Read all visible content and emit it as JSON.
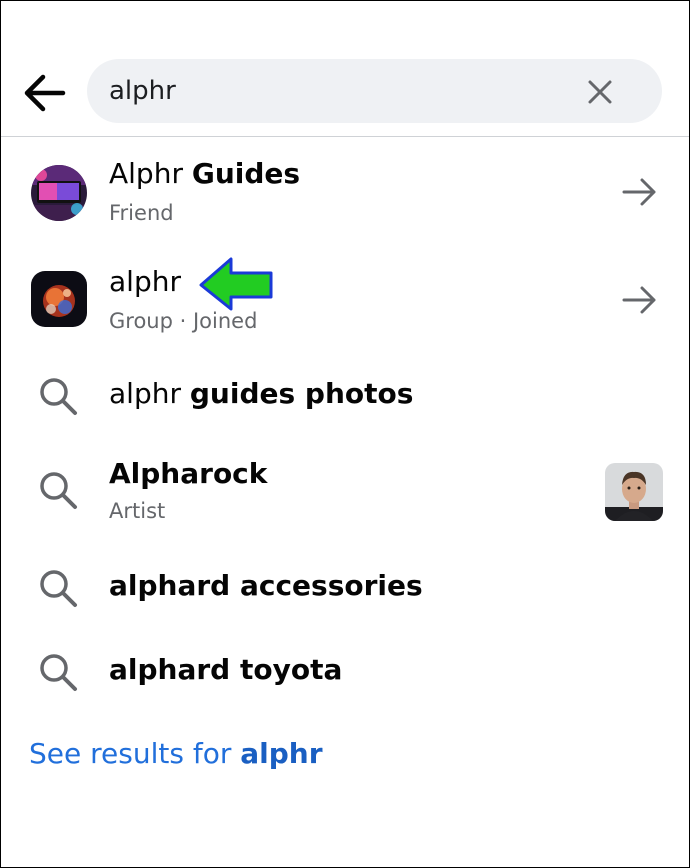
{
  "search": {
    "query": "alphr",
    "placeholder": ""
  },
  "results": {
    "alphr_guides": {
      "title_plain": "Alphr ",
      "title_bold": "Guides",
      "subtitle": "Friend"
    },
    "alphr_group": {
      "title": "alphr",
      "subtitle": "Group · Joined"
    },
    "alphr_guides_photos": {
      "plain": "alphr ",
      "bold": "guides photos"
    },
    "alpharock": {
      "title": "Alpharock",
      "subtitle": "Artist"
    },
    "alphard_accessories": {
      "plain": "alphard accessories"
    },
    "alphard_toyota": {
      "plain": "alphard toyota"
    }
  },
  "see_results": {
    "prefix": "See results for ",
    "query": "alphr"
  },
  "colors": {
    "accent": "#216fdb",
    "annotation_arrow": "#22cc22",
    "search_bg": "#eff1f4",
    "secondary_text": "#65676b"
  },
  "icons": {
    "back": "back-arrow-icon",
    "clear": "close-icon",
    "search": "search-icon",
    "open": "right-arrow-icon"
  }
}
